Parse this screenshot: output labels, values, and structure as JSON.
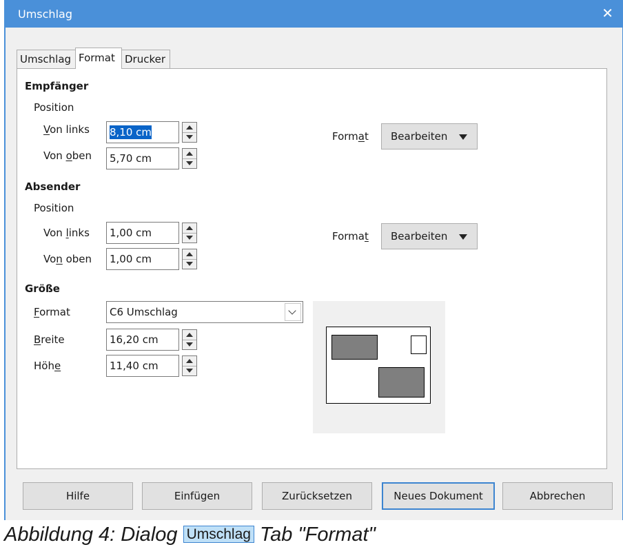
{
  "window": {
    "title": "Umschlag"
  },
  "tabs": [
    {
      "label": "Umschlag",
      "active": false
    },
    {
      "label": "Format",
      "active": true
    },
    {
      "label": "Drucker",
      "active": false
    }
  ],
  "recipient": {
    "section_title": "Empfänger",
    "position_label": "Position",
    "from_left_label": "Von links",
    "from_left_value": "8,10 cm",
    "from_top_label": "Von oben",
    "from_top_value": "5,70 cm",
    "format_label": "Format",
    "edit_button": "Bearbeiten"
  },
  "sender": {
    "section_title": "Absender",
    "position_label": "Position",
    "from_left_label": "Von links",
    "from_left_value": "1,00 cm",
    "from_top_label": "Von oben",
    "from_top_value": "1,00 cm",
    "format_label": "Format",
    "edit_button": "Bearbeiten"
  },
  "size": {
    "section_title": "Größe",
    "format_label": "Format",
    "format_value": "C6 Umschlag",
    "width_label": "Breite",
    "width_value": "16,20 cm",
    "height_label": "Höhe",
    "height_value": "11,40 cm"
  },
  "buttons": {
    "help": "Hilfe",
    "insert": "Einfügen",
    "reset": "Zurücksetzen",
    "new_document": "Neues Dokument",
    "cancel": "Abbrechen"
  },
  "caption": {
    "prefix": "Abbildung 4: Dialog",
    "boxed": "Umschlag",
    "suffix": "Tab \"Format\""
  },
  "colors": {
    "title_bar": "#4a90d9",
    "selection": "#0a64c8",
    "preview_block": "#7f7f7f"
  },
  "icons": {
    "close": "close-icon",
    "spin": "spin-up-down-icon",
    "dropdown": "chevron-down-icon",
    "menu": "triangle-down-icon"
  }
}
